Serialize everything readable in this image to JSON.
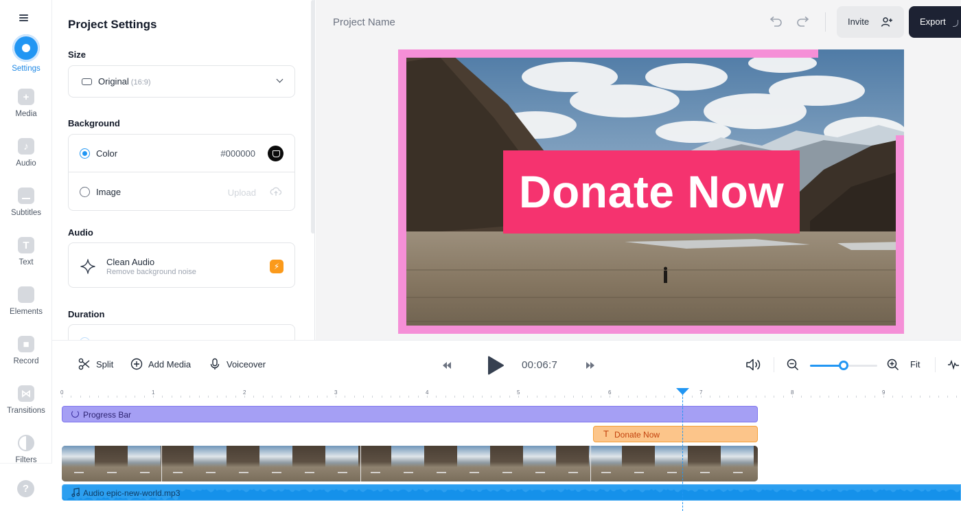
{
  "rail": {
    "items": [
      {
        "label": "Settings",
        "icon": "settings-icon",
        "active": true
      },
      {
        "label": "Media",
        "icon": "plus-square-icon"
      },
      {
        "label": "Audio",
        "icon": "music-note-icon"
      },
      {
        "label": "Subtitles",
        "icon": "subtitles-icon"
      },
      {
        "label": "Text",
        "icon": "text-t-icon"
      },
      {
        "label": "Elements",
        "icon": "elements-icon"
      },
      {
        "label": "Record",
        "icon": "camera-icon"
      },
      {
        "label": "Transitions",
        "icon": "transitions-icon"
      },
      {
        "label": "Filters",
        "icon": "half-circle-icon"
      }
    ],
    "help_icon": "?"
  },
  "panel": {
    "title": "Project Settings",
    "size": {
      "label": "Size",
      "value": "Original",
      "hint": "(16:9)"
    },
    "background": {
      "label": "Background",
      "color_option": "Color",
      "color_value": "#000000",
      "image_option": "Image",
      "upload_label": "Upload",
      "selected": "Color"
    },
    "audio": {
      "label": "Audio",
      "title": "Clean Audio",
      "subtitle": "Remove background noise"
    },
    "duration": {
      "label": "Duration"
    }
  },
  "topbar": {
    "project_name": "Project Name",
    "invite_label": "Invite",
    "export_label": "Export"
  },
  "canvas": {
    "overlay_text": "Donate Now",
    "overlay_color": "#f5336f",
    "progress_bar_color": "#f58fd7",
    "progress_fraction": 0.83
  },
  "controls": {
    "split_label": "Split",
    "add_media_label": "Add Media",
    "voiceover_label": "Voiceover",
    "time": "00:06:7",
    "fit_label": "Fit",
    "zoom_level": 0.5
  },
  "timeline": {
    "ruler_labels": [
      "0",
      "1",
      "2",
      "3",
      "4",
      "5",
      "6",
      "7",
      "8",
      "9"
    ],
    "playhead_seconds": 6.8,
    "tracks": {
      "progress_label": "Progress Bar",
      "text_label": "Donate Now",
      "audio_label": "Audio epic-new-world.mp3"
    }
  },
  "colors": {
    "accent": "#2196f3",
    "export_bg": "#1d2233",
    "progress_track": "#a59ff4",
    "text_track": "#fcc58a",
    "audio_track": "#2c9ff0"
  }
}
